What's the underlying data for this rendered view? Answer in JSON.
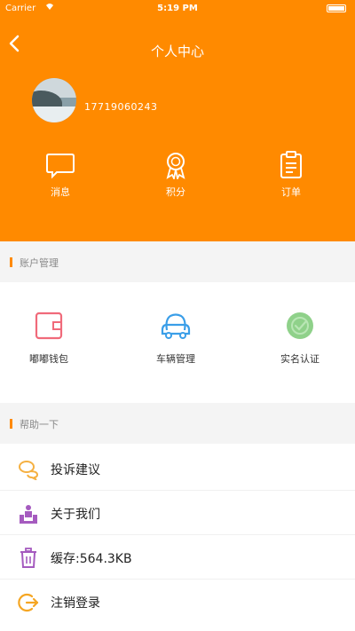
{
  "status_bar": {
    "carrier": "Carrier",
    "wifi_icon": "wifi-icon",
    "time": "5:19 PM",
    "battery_icon": "battery-icon"
  },
  "nav": {
    "back_icon": "back-chevron-icon",
    "title": "个人中心"
  },
  "profile": {
    "avatar_icon": "avatar",
    "phone": "17719060243"
  },
  "quick_actions": [
    {
      "label": "消息",
      "icon": "message-icon"
    },
    {
      "label": "积分",
      "icon": "medal-icon"
    },
    {
      "label": "订单",
      "icon": "clipboard-icon"
    }
  ],
  "account_section": {
    "title": "账户管理",
    "items": [
      {
        "label": "嘟嘟钱包",
        "icon": "wallet-icon",
        "color": "#f06a7a"
      },
      {
        "label": "车辆管理",
        "icon": "car-icon",
        "color": "#3a9ee8"
      },
      {
        "label": "实名认证",
        "icon": "verified-badge-icon",
        "color": "#8fd18a"
      }
    ]
  },
  "help_section": {
    "title": "帮助一下",
    "items": [
      {
        "label": "投诉建议",
        "icon": "chat-bubbles-icon",
        "color": "#f5b041"
      },
      {
        "label": "关于我们",
        "icon": "team-icon",
        "color": "#a55bbf"
      },
      {
        "label": "缓存:564.3KB",
        "icon": "trash-icon",
        "color": "#a55bbf"
      },
      {
        "label": "注销登录",
        "icon": "logout-icon",
        "color": "#f5a623"
      }
    ]
  },
  "colors": {
    "brand": "#ff8a00",
    "section_bg": "#f4f4f4"
  }
}
